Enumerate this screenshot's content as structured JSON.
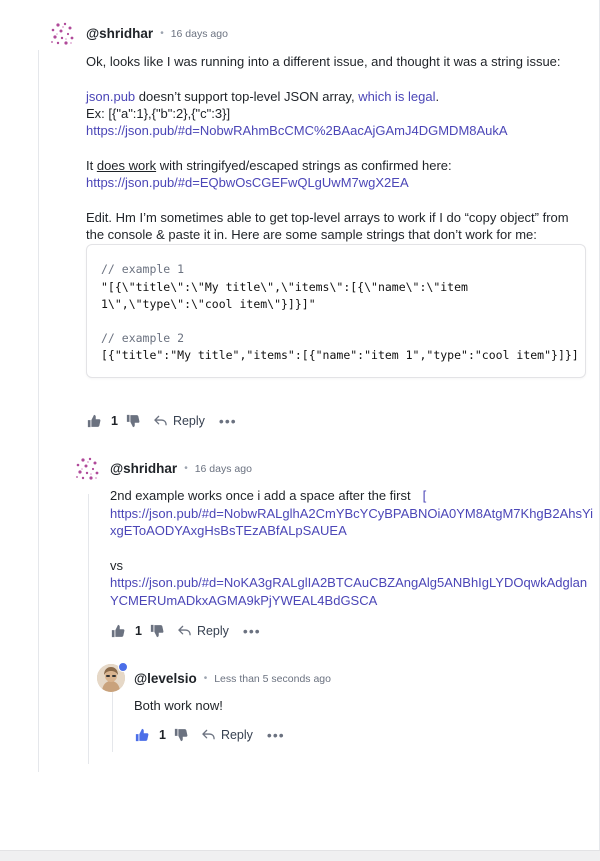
{
  "comments": [
    {
      "handle": "@shridhar",
      "time": "16 days ago",
      "lines": {
        "intro": "Ok, looks like I was running into a different issue, and thought it was a string issue:",
        "jsonpub": "json.pub",
        "doesnt": " doesn’t support top-level JSON array, ",
        "legal_link": "which is legal",
        "period": ".",
        "ex": "Ex: [{\"a\":1},{\"b\":2},{\"c\":3}]",
        "url1": "https://json.pub/#d=NobwRAhmBcCMC%2BAacAjGAmJ4DGMDM8AukA",
        "it": "It ",
        "does_work": "does work",
        "confirmed": " with stringifyed/escaped strings as confirmed here:",
        "url2": "https://json.pub/#d=EQbwOsCGEFwQLgUwM7wgX2EA",
        "edit1": "Edit. Hm I’m sometimes able to get top-level arrays to work if I do “copy object” from",
        "edit2": "the console & paste it in. Here are some sample strings that don’t work for me:"
      },
      "code": {
        "c1": "// example 1",
        "l1": "\"[{\\\"title\\\":\\\"My title\\\",\\\"items\\\":[{\\\"name\\\":\\\"item",
        "l2": "1\\\",\\\"type\\\":\\\"cool item\\\"}]}]\"",
        "c2": "// example 2",
        "l3": "[{\"title\":\"My title\",\"items\":[{\"name\":\"item 1\",\"type\":\"cool item\"}]}]"
      },
      "likes": "1",
      "reply_label": "Reply",
      "more_label": "•••"
    },
    {
      "handle": "@shridhar",
      "time": "16 days ago",
      "lines": {
        "t1": "2nd example works once i add a space after the first",
        "bracket": "[",
        "u1a": "https://json.pub/#d=NobwRALglhA2CmYBcYCyBPABNOiA0YM8AtgM7KhgB2AhsYi",
        "u1b": "xgEToAODYAxgHsBsTEzABfALpSAUEA",
        "vs": "vs",
        "u2a": "https://json.pub/#d=NoKA3gRALglIA2BTCAuCBZAngAlg5ANBhIgLYDOqwkAdglan",
        "u2b": "YCMERUmADkxAGMA9kPjYWEAL4BdGSCA"
      },
      "likes": "1",
      "reply_label": "Reply",
      "more_label": "•••"
    },
    {
      "handle": "@levelsio",
      "time": "Less than 5 seconds ago",
      "body": "Both work now!",
      "likes": "1",
      "reply_label": "Reply",
      "more_label": "•••"
    }
  ],
  "colors": {
    "link": "#4b46b7",
    "like_active": "#4b6ee8",
    "avatar": "#b04a9a"
  },
  "icons": [
    "dots-avatar-icon",
    "thumbs-up-icon",
    "thumbs-down-icon",
    "reply-arrow-icon",
    "more-icon",
    "verified-badge-icon"
  ]
}
